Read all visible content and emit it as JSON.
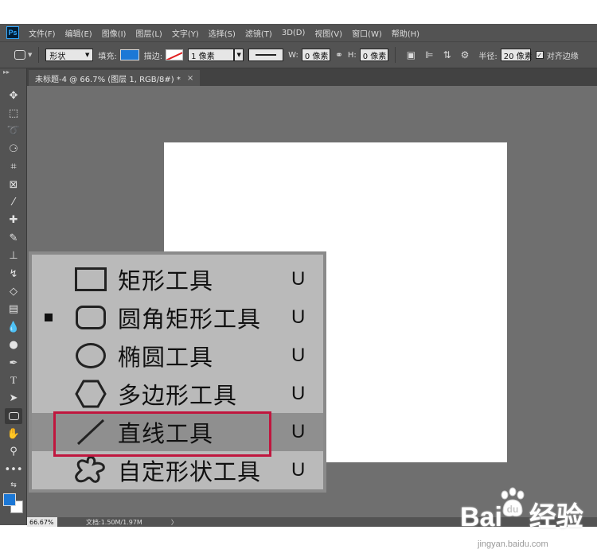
{
  "menubar": {
    "logo": "Ps",
    "items": [
      "文件(F)",
      "编辑(E)",
      "图像(I)",
      "图层(L)",
      "文字(Y)",
      "选择(S)",
      "滤镜(T)",
      "3D(D)",
      "视图(V)",
      "窗口(W)",
      "帮助(H)"
    ]
  },
  "options": {
    "mode": "形状",
    "fill_label": "填充:",
    "stroke_label": "描边:",
    "stroke_width": "1 像素",
    "w_label": "W:",
    "w_value": "0 像素",
    "h_label": "H:",
    "h_value": "0 像素",
    "radius_label": "半径:",
    "radius_value": "20 像素",
    "align_edges": "对齐边缘",
    "fill_color": "#1c78d6"
  },
  "tab": {
    "title": "未标题-4 @ 66.7% (图层 1, RGB/8#) *",
    "close": "×"
  },
  "status": {
    "zoom": "66.67%",
    "doc": "文档:1.50M/1.97M",
    "arrow": "〉"
  },
  "flyout": {
    "items": [
      {
        "label": "矩形工具",
        "key": "U",
        "icon": "rectangle-icon",
        "selected": false
      },
      {
        "label": "圆角矩形工具",
        "key": "U",
        "icon": "rounded-rectangle-icon",
        "selected": true
      },
      {
        "label": "椭圆工具",
        "key": "U",
        "icon": "ellipse-icon",
        "selected": false
      },
      {
        "label": "多边形工具",
        "key": "U",
        "icon": "polygon-icon",
        "selected": false
      },
      {
        "label": "直线工具",
        "key": "U",
        "icon": "line-icon",
        "selected": false,
        "highlighted": true
      },
      {
        "label": "自定形状工具",
        "key": "U",
        "icon": "custom-shape-icon",
        "selected": false
      }
    ]
  },
  "watermark": {
    "brand": "Bai",
    "brand2": "经验",
    "url": "jingyan.baidu.com"
  },
  "colors": {
    "foreground": "#1c78d6",
    "background": "#ffffff",
    "highlight_border": "#c0163e"
  }
}
